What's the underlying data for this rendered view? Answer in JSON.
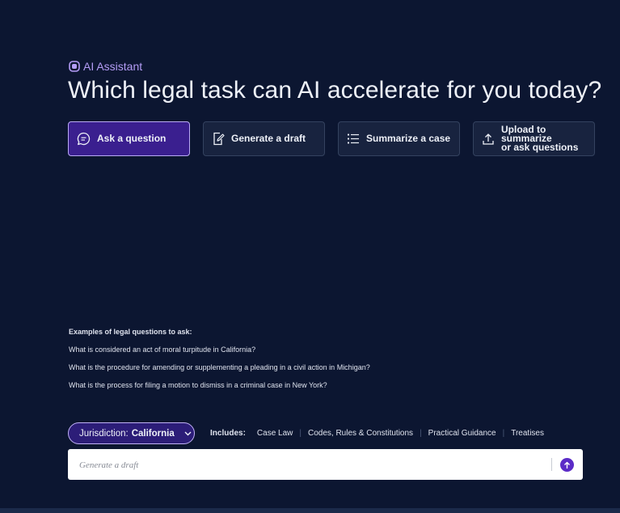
{
  "header": {
    "assistant_label": "AI Assistant",
    "assistant_icon": "chat-bubble-icon",
    "headline": "Which legal task can AI accelerate for you today?"
  },
  "tasks": [
    {
      "label": "Ask a question",
      "icon": "chat-bubble-icon",
      "active": true
    },
    {
      "label": "Generate a draft",
      "icon": "edit-document-icon",
      "active": false
    },
    {
      "label": "Summarize a case",
      "icon": "list-icon",
      "active": false
    },
    {
      "label_line1": "Upload to summarize",
      "label_line2": "or ask questions",
      "icon": "upload-icon",
      "active": false
    }
  ],
  "examples": {
    "title": "Examples of legal questions to ask:",
    "items": [
      "What is considered an act of moral turpitude in California?",
      "What is the procedure for amending or supplementing a pleading in a civil action in Michigan?",
      "What is the process for filing a motion to dismiss in a criminal case in New York?"
    ]
  },
  "jurisdiction": {
    "prefix": "Jurisdiction:",
    "value": "California"
  },
  "includes": {
    "label": "Includes:",
    "sources": [
      "Case Law",
      "Codes, Rules & Constitutions",
      "Practical Guidance",
      "Treatises"
    ]
  },
  "prompt": {
    "placeholder": "Generate a draft",
    "send_icon": "arrow-up-icon"
  },
  "colors": {
    "background": "#0c1631",
    "accent": "#5b2bc7",
    "active_card": "#3a1f8f",
    "label_purple": "#b39cf5"
  }
}
